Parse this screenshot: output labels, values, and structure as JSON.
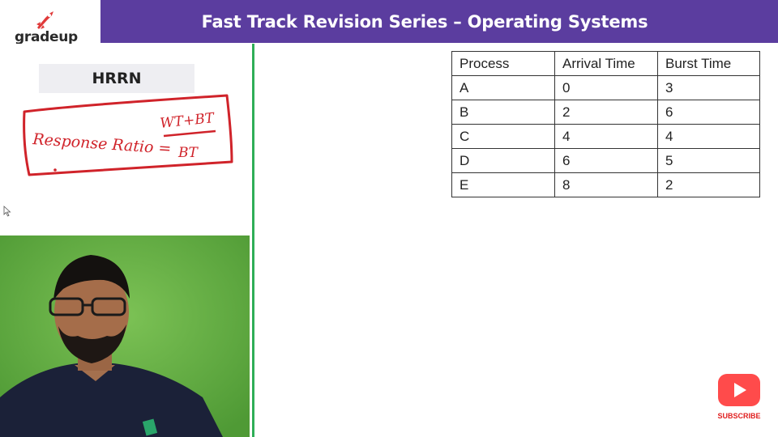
{
  "brand": {
    "logo_text": "gradeup",
    "logo_icon": "rocket-icon",
    "accent_color": "#e03a3a",
    "header_color": "#5b3d9f",
    "divider_color": "#2fae57"
  },
  "header": {
    "title": "Fast Track Revision Series – Operating Systems"
  },
  "left_panel": {
    "topic": "HRRN",
    "formula": {
      "label": "Response Ratio =",
      "numerator": "WT+BT",
      "denominator": "BT"
    }
  },
  "process_table": {
    "columns": [
      "Process",
      "Arrival Time",
      "Burst Time"
    ],
    "rows": [
      [
        "A",
        "0",
        "3"
      ],
      [
        "B",
        "2",
        "6"
      ],
      [
        "C",
        "4",
        "4"
      ],
      [
        "D",
        "6",
        "5"
      ],
      [
        "E",
        "8",
        "2"
      ]
    ]
  },
  "subscribe": {
    "label": "SUBSCRIBE",
    "icon": "play-icon"
  }
}
